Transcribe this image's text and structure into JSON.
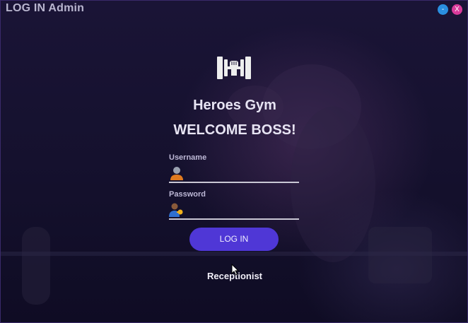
{
  "window": {
    "title": "LOG IN Admin",
    "minimize_label": "-",
    "close_label": "X"
  },
  "brand": {
    "name": "Heroes Gym",
    "welcome": "WELCOME BOSS!",
    "logo_icon": "dumbbell-fist-icon"
  },
  "form": {
    "username_label": "Username",
    "username_value": "",
    "username_icon": "user-icon",
    "password_label": "Password",
    "password_value": "",
    "password_icon": "user-key-icon",
    "login_label": "LOG IN"
  },
  "footer": {
    "switch_link": "Receptionist"
  },
  "colors": {
    "accent": "#4f37d6",
    "minimize": "#2a8fe0",
    "close": "#d93a9a"
  }
}
